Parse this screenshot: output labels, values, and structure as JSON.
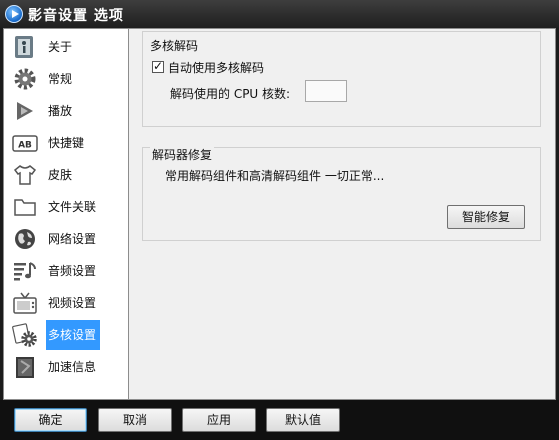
{
  "window": {
    "title": "影音设置 选项"
  },
  "sidebar": {
    "items": [
      {
        "label": "关于",
        "icon": "info-icon"
      },
      {
        "label": "常规",
        "icon": "gear-icon"
      },
      {
        "label": "播放",
        "icon": "play-icon"
      },
      {
        "label": "快捷键",
        "icon": "keyboard-ab-icon"
      },
      {
        "label": "皮肤",
        "icon": "tshirt-icon"
      },
      {
        "label": "文件关联",
        "icon": "folder-icon"
      },
      {
        "label": "网络设置",
        "icon": "globe-icon"
      },
      {
        "label": "音频设置",
        "icon": "audio-icon"
      },
      {
        "label": "视频设置",
        "icon": "tv-icon"
      },
      {
        "label": "多核设置",
        "icon": "multicore-gear-icon",
        "selected": true
      },
      {
        "label": "加速信息",
        "icon": "accelerate-book-icon"
      }
    ],
    "selected_color": "#3399ff"
  },
  "multicore": {
    "title": "多核解码",
    "auto_checkbox_label": "自动使用多核解码",
    "auto_checked": true,
    "cpu_count_label": "解码使用的 CPU 核数:",
    "cpu_count_value": ""
  },
  "repair": {
    "title": "解码器修复",
    "status_text": "常用解码组件和高清解码组件 一切正常...",
    "repair_button": "智能修复"
  },
  "footer": {
    "ok": "确定",
    "cancel": "取消",
    "apply": "应用",
    "default": "默认值"
  }
}
